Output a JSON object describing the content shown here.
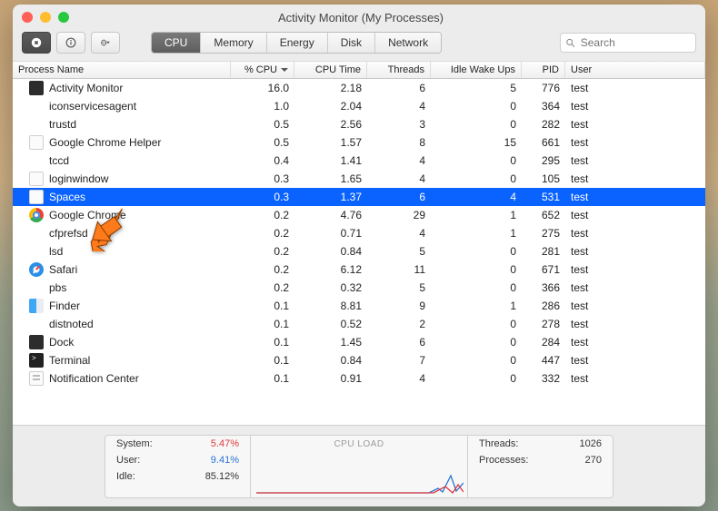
{
  "window": {
    "title": "Activity Monitor (My Processes)"
  },
  "tabs": {
    "cpu": "CPU",
    "memory": "Memory",
    "energy": "Energy",
    "disk": "Disk",
    "network": "Network"
  },
  "search": {
    "placeholder": "Search"
  },
  "columns": {
    "name": "Process Name",
    "cpu": "% CPU",
    "time": "CPU Time",
    "threads": "Threads",
    "idle": "Idle Wake Ups",
    "pid": "PID",
    "user": "User"
  },
  "rows": [
    {
      "name": "Activity Monitor",
      "cpu": "16.0",
      "time": "2.18",
      "threads": "6",
      "idle": "5",
      "pid": "776",
      "user": "test",
      "icon": "dark"
    },
    {
      "name": "iconservicesagent",
      "cpu": "1.0",
      "time": "2.04",
      "threads": "4",
      "idle": "0",
      "pid": "364",
      "user": "test",
      "icon": "blank"
    },
    {
      "name": "trustd",
      "cpu": "0.5",
      "time": "2.56",
      "threads": "3",
      "idle": "0",
      "pid": "282",
      "user": "test",
      "icon": "blank"
    },
    {
      "name": "Google Chrome Helper",
      "cpu": "0.5",
      "time": "1.57",
      "threads": "8",
      "idle": "15",
      "pid": "661",
      "user": "test",
      "icon": "white"
    },
    {
      "name": "tccd",
      "cpu": "0.4",
      "time": "1.41",
      "threads": "4",
      "idle": "0",
      "pid": "295",
      "user": "test",
      "icon": "blank"
    },
    {
      "name": "loginwindow",
      "cpu": "0.3",
      "time": "1.65",
      "threads": "4",
      "idle": "0",
      "pid": "105",
      "user": "test",
      "icon": "white"
    },
    {
      "name": "Spaces",
      "cpu": "0.3",
      "time": "1.37",
      "threads": "6",
      "idle": "4",
      "pid": "531",
      "user": "test",
      "icon": "white",
      "selected": true
    },
    {
      "name": "Google Chrome",
      "cpu": "0.2",
      "time": "4.76",
      "threads": "29",
      "idle": "1",
      "pid": "652",
      "user": "test",
      "icon": "chrome"
    },
    {
      "name": "cfprefsd",
      "cpu": "0.2",
      "time": "0.71",
      "threads": "4",
      "idle": "1",
      "pid": "275",
      "user": "test",
      "icon": "blank"
    },
    {
      "name": "lsd",
      "cpu": "0.2",
      "time": "0.84",
      "threads": "5",
      "idle": "0",
      "pid": "281",
      "user": "test",
      "icon": "blank"
    },
    {
      "name": "Safari",
      "cpu": "0.2",
      "time": "6.12",
      "threads": "11",
      "idle": "0",
      "pid": "671",
      "user": "test",
      "icon": "safari"
    },
    {
      "name": "pbs",
      "cpu": "0.2",
      "time": "0.32",
      "threads": "5",
      "idle": "0",
      "pid": "366",
      "user": "test",
      "icon": "blank"
    },
    {
      "name": "Finder",
      "cpu": "0.1",
      "time": "8.81",
      "threads": "9",
      "idle": "1",
      "pid": "286",
      "user": "test",
      "icon": "finder"
    },
    {
      "name": "distnoted",
      "cpu": "0.1",
      "time": "0.52",
      "threads": "2",
      "idle": "0",
      "pid": "278",
      "user": "test",
      "icon": "blank"
    },
    {
      "name": "Dock",
      "cpu": "0.1",
      "time": "1.45",
      "threads": "6",
      "idle": "0",
      "pid": "284",
      "user": "test",
      "icon": "dock"
    },
    {
      "name": "Terminal",
      "cpu": "0.1",
      "time": "0.84",
      "threads": "7",
      "idle": "0",
      "pid": "447",
      "user": "test",
      "icon": "term"
    },
    {
      "name": "Notification Center",
      "cpu": "0.1",
      "time": "0.91",
      "threads": "4",
      "idle": "0",
      "pid": "332",
      "user": "test",
      "icon": "notif"
    }
  ],
  "footer": {
    "system_label": "System:",
    "system_value": "5.47%",
    "user_label": "User:",
    "user_value": "9.41%",
    "idle_label": "Idle:",
    "idle_value": "85.12%",
    "graph_label": "CPU LOAD",
    "threads_label": "Threads:",
    "threads_value": "1026",
    "processes_label": "Processes:",
    "processes_value": "270"
  }
}
